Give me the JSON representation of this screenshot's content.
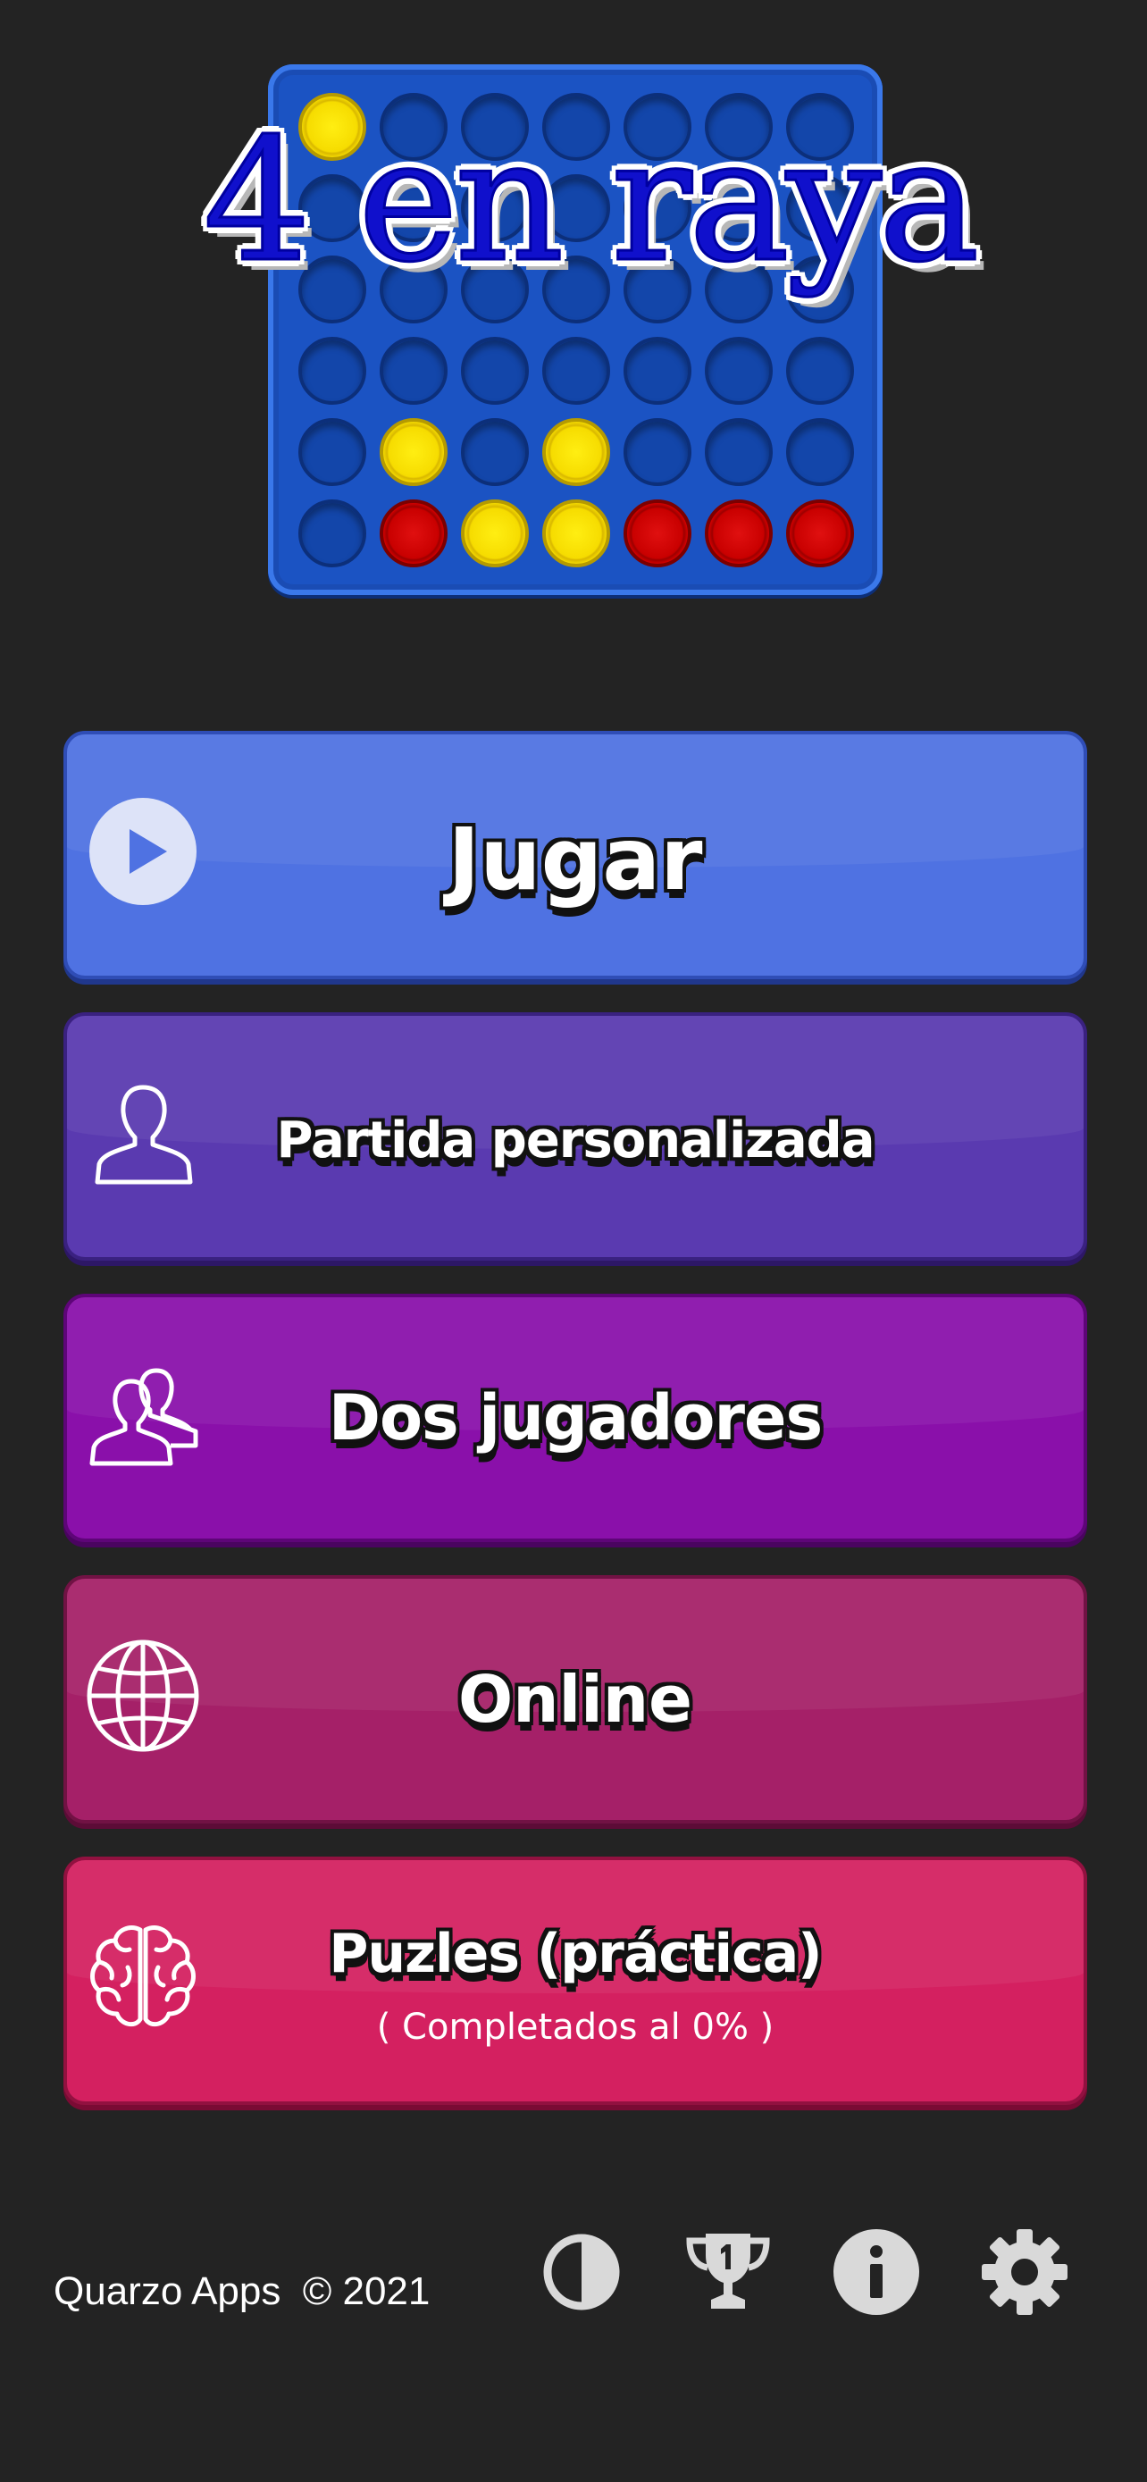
{
  "logo": {
    "title": "4 en raya",
    "board_rows": [
      [
        "yellow",
        "empty",
        "empty",
        "empty",
        "empty",
        "empty",
        "empty"
      ],
      [
        "empty",
        "empty",
        "empty",
        "empty",
        "empty",
        "empty",
        "empty"
      ],
      [
        "empty",
        "empty",
        "empty",
        "empty",
        "empty",
        "empty",
        "empty"
      ],
      [
        "empty",
        "empty",
        "empty",
        "empty",
        "empty",
        "empty",
        "empty"
      ],
      [
        "empty",
        "yellow",
        "empty",
        "yellow",
        "empty",
        "empty",
        "empty"
      ],
      [
        "empty",
        "red",
        "yellow",
        "yellow",
        "red",
        "red",
        "red"
      ]
    ]
  },
  "menu": {
    "play": {
      "label": "Jugar",
      "icon": "play-circle-icon",
      "color": "#4f72e2"
    },
    "custom": {
      "label": "Partida personalizada",
      "icon": "user-icon",
      "color": "#5a3ab0"
    },
    "two_players": {
      "label": "Dos jugadores",
      "icon": "users-icon",
      "color": "#8a10aa"
    },
    "online": {
      "label": "Online",
      "icon": "globe-icon",
      "color": "#a52068"
    },
    "puzzles": {
      "label": "Puzles (práctica)",
      "subtitle": "( Completados al 0% )",
      "icon": "brain-icon",
      "color": "#d42060"
    }
  },
  "footer": {
    "copyright": "Quarzo Apps  © 2021",
    "icons": [
      "contrast-icon",
      "trophy-icon",
      "info-icon",
      "gear-icon"
    ]
  },
  "colors": {
    "background": "#232323",
    "board": "#1b53c3",
    "yellow_disc": "#f6dc00",
    "red_disc": "#c90000"
  }
}
